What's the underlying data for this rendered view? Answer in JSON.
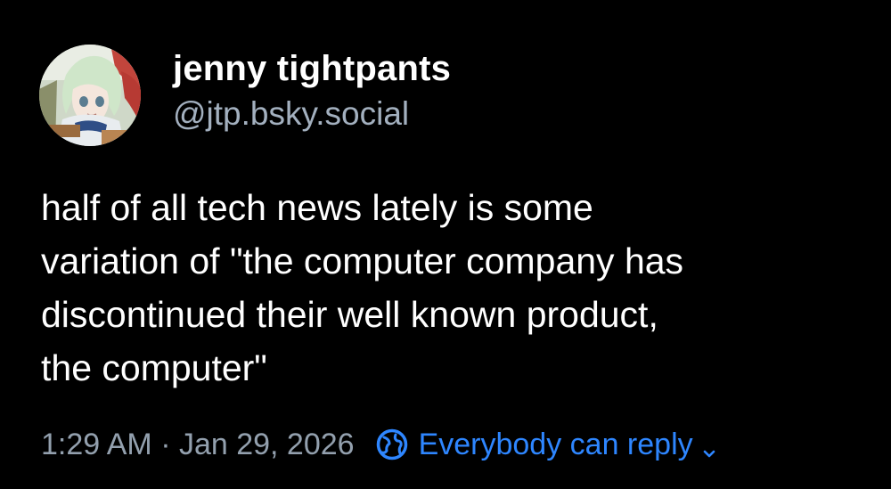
{
  "author": {
    "display_name": "jenny tightpants",
    "handle": "@jtp.bsky.social",
    "avatar_icon": "anime-character-avatar"
  },
  "post": {
    "text": "half of all tech news lately is some\nvariation of \"the computer company has\ndiscontinued their well known product,\nthe computer\""
  },
  "meta": {
    "timestamp": "1:29 AM · Jan 29, 2026",
    "reply_setting": "Everybody can reply",
    "reply_icon": "globe-icon",
    "chevron_icon": "chevron-down-icon"
  },
  "colors": {
    "background": "#000000",
    "text": "#ffffff",
    "handle": "#a3b0bf",
    "timestamp": "#93a0ae",
    "accent": "#2e86ff"
  }
}
